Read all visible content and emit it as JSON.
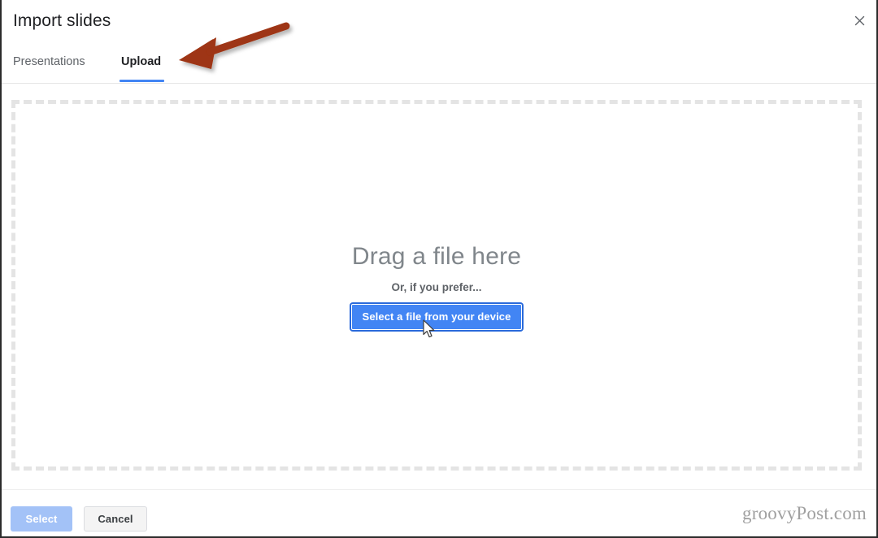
{
  "dialog": {
    "title": "Import slides",
    "close_label": "×",
    "close_icon": "close-icon"
  },
  "tabs": [
    {
      "label": "Presentations",
      "active": false
    },
    {
      "label": "Upload",
      "active": true
    }
  ],
  "dropzone": {
    "headline": "Drag a file here",
    "subtext": "Or, if you prefer...",
    "button_label": "Select a file from your device"
  },
  "footer": {
    "select_label": "Select",
    "cancel_label": "Cancel",
    "watermark": "groovyPost.com"
  },
  "annotation": {
    "arrow_icon": "arrow-pointing-left-icon"
  },
  "cursor": {
    "icon": "mouse-pointer-icon"
  },
  "colors": {
    "accent_blue": "#4285f4",
    "tab_underline": "#4285f4",
    "select_disabled": "#a3c2f7",
    "annotation_red": "#9e3412",
    "dashed_border": "#e4e4e4",
    "headline_gray": "#80868b",
    "title_text": "#202124",
    "secondary_text": "#5f6368"
  }
}
